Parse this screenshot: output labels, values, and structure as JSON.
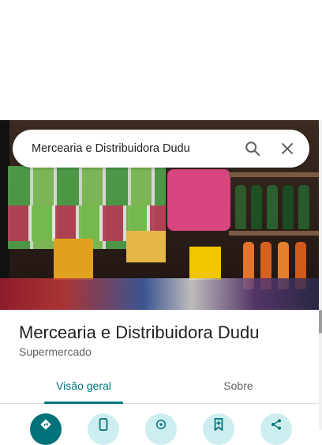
{
  "search": {
    "query": "Mercearia e Distribuidora Dudu"
  },
  "place": {
    "name": "Mercearia e Distribuidora Dudu",
    "category": "Supermercado"
  },
  "tabs": [
    {
      "label": "Visão geral",
      "active": true
    },
    {
      "label": "Sobre",
      "active": false
    }
  ],
  "actions": [
    {
      "icon": "directions-icon"
    },
    {
      "icon": "phone-icon"
    },
    {
      "icon": "explore-icon"
    },
    {
      "icon": "save-icon"
    },
    {
      "icon": "share-icon"
    }
  ],
  "colors": {
    "accent": "#00737a",
    "accent_light": "#cdeef0",
    "text_primary": "#202124",
    "text_secondary": "#5f6368"
  }
}
